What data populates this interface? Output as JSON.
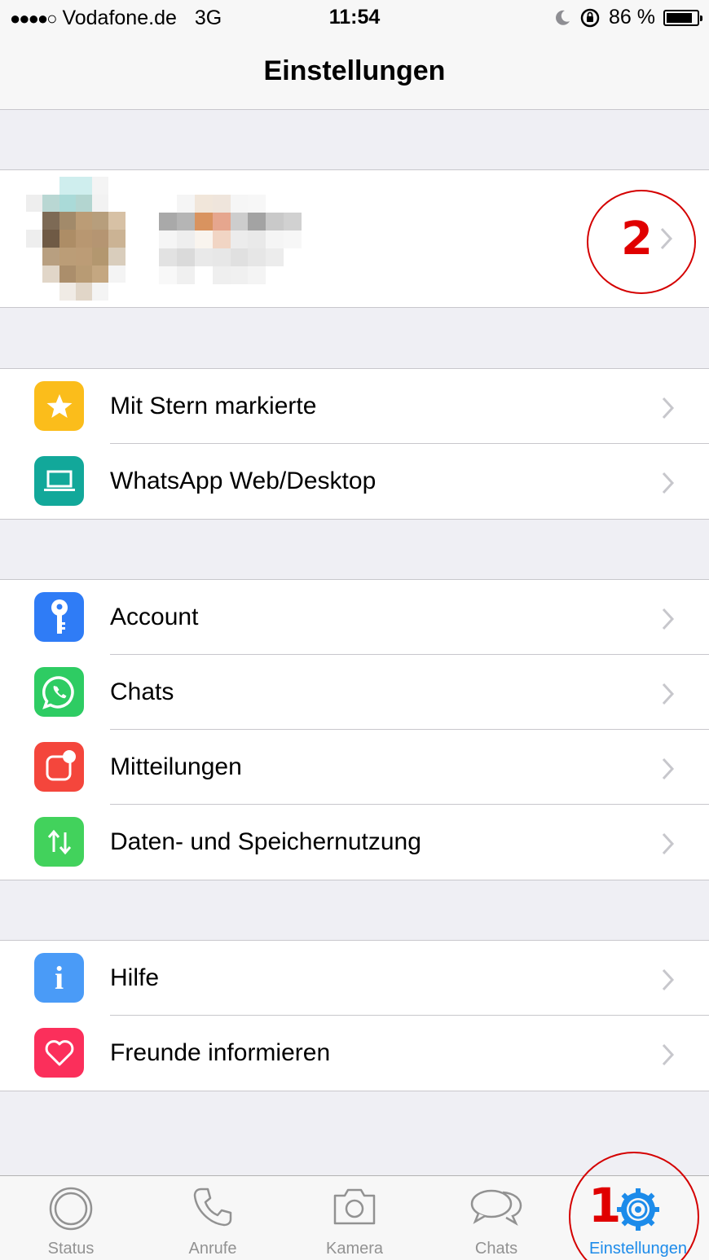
{
  "status_bar": {
    "signal": "●●●●○",
    "carrier": "Vodafone.de",
    "network": "3G",
    "time": "11:54",
    "battery": "86 %",
    "battery_level": 0.86
  },
  "nav": {
    "title": "Einstellungen"
  },
  "profile": {
    "annotation": "2"
  },
  "groups": [
    {
      "items": [
        {
          "label": "Mit Stern markierte",
          "icon": "star-icon",
          "color": "#fbbd1b"
        },
        {
          "label": "WhatsApp Web/Desktop",
          "icon": "laptop-icon",
          "color": "#12a89a"
        }
      ]
    },
    {
      "items": [
        {
          "label": "Account",
          "icon": "key-icon",
          "color": "#2f7cf6"
        },
        {
          "label": "Chats",
          "icon": "whatsapp-icon",
          "color": "#2ecc63"
        },
        {
          "label": "Mitteilungen",
          "icon": "notification-icon",
          "color": "#f4463c"
        },
        {
          "label": "Daten- und Speichernutzung",
          "icon": "data-arrows-icon",
          "color": "#42d25c"
        }
      ]
    },
    {
      "items": [
        {
          "label": "Hilfe",
          "icon": "info-icon",
          "color": "#4a9bf7"
        },
        {
          "label": "Freunde informieren",
          "icon": "heart-icon",
          "color": "#fb2f5b"
        }
      ]
    }
  ],
  "tabs": [
    {
      "label": "Status",
      "icon": "status-icon",
      "active": false
    },
    {
      "label": "Anrufe",
      "icon": "phone-icon",
      "active": false
    },
    {
      "label": "Kamera",
      "icon": "camera-icon",
      "active": false
    },
    {
      "label": "Chats",
      "icon": "chat-bubbles-icon",
      "active": false
    },
    {
      "label": "Einstellungen",
      "icon": "gear-icon",
      "active": true,
      "annotation": "1"
    }
  ],
  "colors": {
    "accent": "#1c8bea",
    "annotation": "#e00000",
    "inactive_tab": "#929292"
  }
}
